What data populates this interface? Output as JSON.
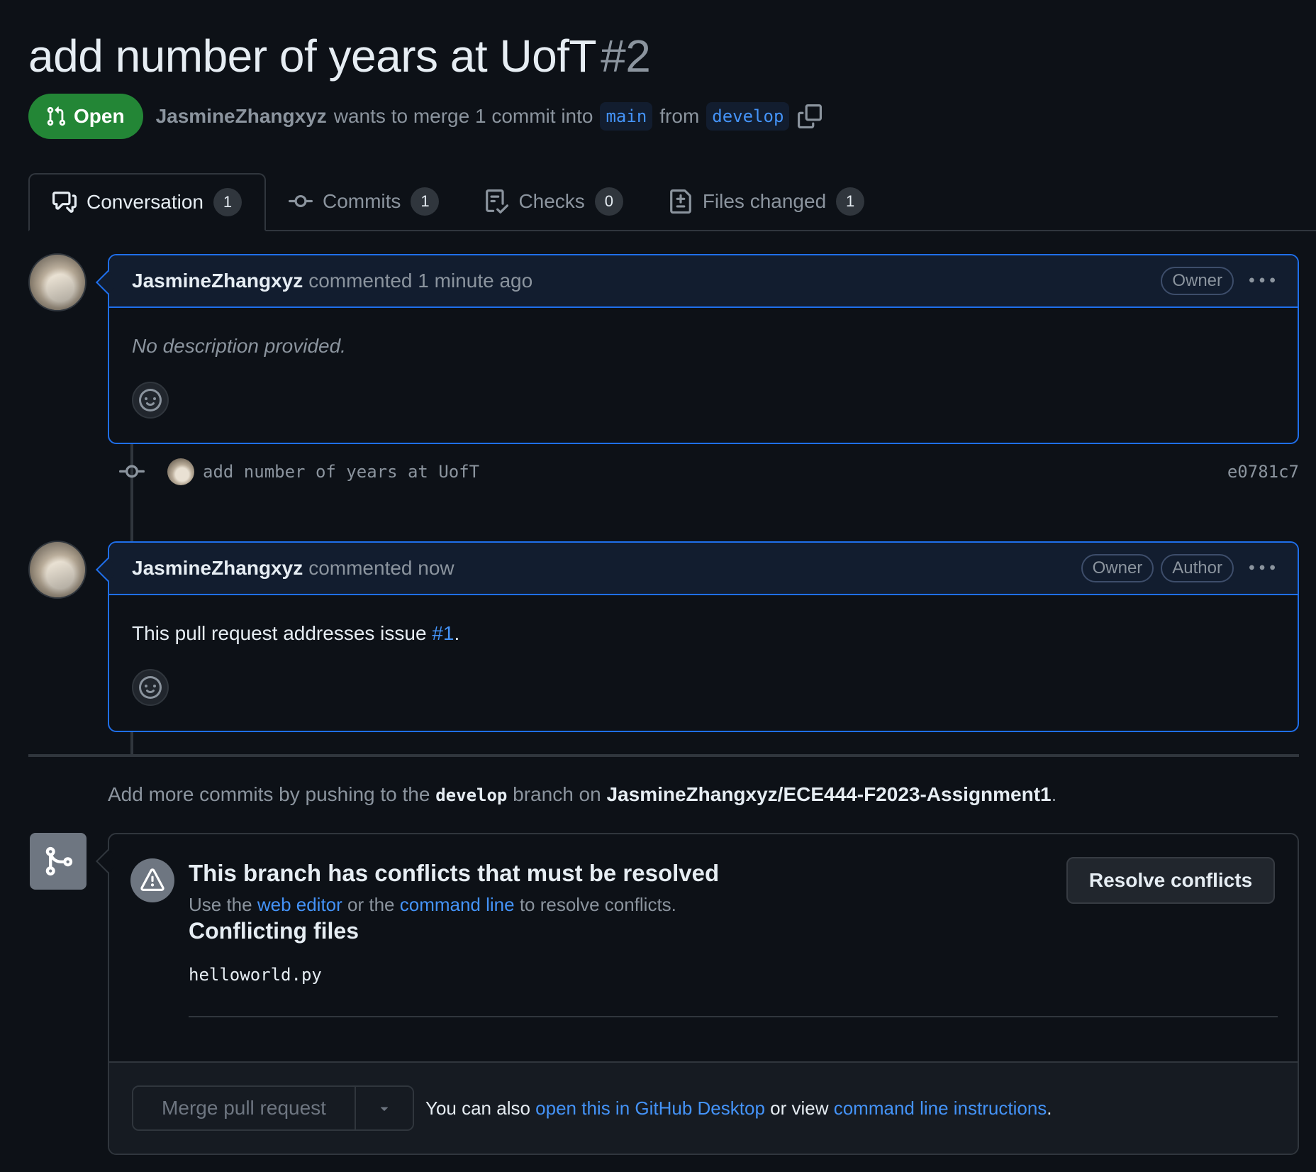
{
  "pr": {
    "title": "add number of years at UofT",
    "number": "#2",
    "state": "Open",
    "author": "JasmineZhangxyz",
    "merge_text_1": "wants to merge 1 commit into",
    "base_branch": "main",
    "merge_text_2": "from",
    "head_branch": "develop"
  },
  "tabs": [
    {
      "label": "Conversation",
      "count": "1",
      "icon": "comment-discussion-icon",
      "active": true
    },
    {
      "label": "Commits",
      "count": "1",
      "icon": "git-commit-icon"
    },
    {
      "label": "Checks",
      "count": "0",
      "icon": "checklist-icon"
    },
    {
      "label": "Files changed",
      "count": "1",
      "icon": "file-diff-icon"
    }
  ],
  "comments": [
    {
      "author": "JasmineZhangxyz",
      "when": "commented 1 minute ago",
      "roles": [
        "Owner"
      ],
      "body": "No description provided."
    },
    {
      "author": "JasmineZhangxyz",
      "when": "commented now",
      "roles": [
        "Owner",
        "Author"
      ],
      "body_prefix": "This pull request addresses issue ",
      "body_link": "#1",
      "body_suffix": "."
    }
  ],
  "commit": {
    "message": "add number of years at UofT",
    "sha": "e0781c7"
  },
  "push_note": {
    "prefix": "Add more commits by pushing to the ",
    "branch": "develop",
    "middle": " branch on ",
    "repo": "JasmineZhangxyz/ECE444-F2023-Assignment1",
    "suffix": "."
  },
  "conflicts": {
    "title": "This branch has conflicts that must be resolved",
    "sub_prefix": "Use the ",
    "web_editor": "web editor",
    "sub_middle": " or the ",
    "command_line": "command line",
    "sub_suffix": " to resolve conflicts.",
    "files_title": "Conflicting files",
    "files": [
      "helloworld.py"
    ],
    "resolve_button": "Resolve conflicts"
  },
  "merge": {
    "button": "Merge pull request",
    "footer_prefix": "You can also ",
    "desktop_link": "open this in GitHub Desktop",
    "footer_middle": " or view ",
    "cli_link": "command line instructions",
    "footer_suffix": "."
  },
  "colors": {
    "background": "#0d1117",
    "open_green": "#238636",
    "link_blue": "#4493f8",
    "comment_border": "#1f6feb"
  }
}
